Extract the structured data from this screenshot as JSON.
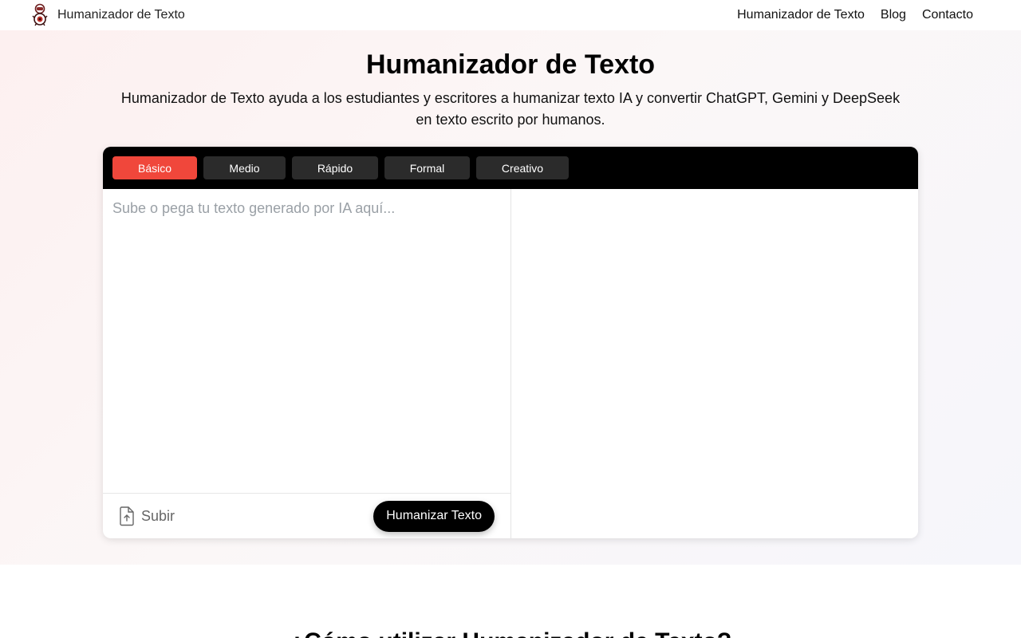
{
  "nav": {
    "brand": "Humanizador de Texto",
    "logo_icon": "robot-logo-icon",
    "links": [
      "Humanizador de Texto",
      "Blog",
      "Contacto"
    ]
  },
  "hero": {
    "title": "Humanizador de Texto",
    "subtitle": "Humanizador de Texto ayuda a los estudiantes y escritores a humanizar texto IA y convertir ChatGPT, Gemini y DeepSeek en texto escrito por humanos."
  },
  "tool": {
    "modes": [
      "Básico",
      "Medio",
      "Rápido",
      "Formal",
      "Creativo"
    ],
    "active_mode": "Básico",
    "input_placeholder": "Sube o pega tu texto generado por IA aquí...",
    "input_value": "",
    "upload_label": "Subir",
    "upload_icon": "file-upload-icon",
    "humanize_label": "Humanizar Texto",
    "output_text": ""
  },
  "section": {
    "heading": "¿Cómo utilizar Humanizador de Texto?"
  },
  "colors": {
    "accent": "#f0473b",
    "tab_bg": "#2b2b2b",
    "toolbar_bg": "#000000",
    "button_bg": "#000000"
  }
}
